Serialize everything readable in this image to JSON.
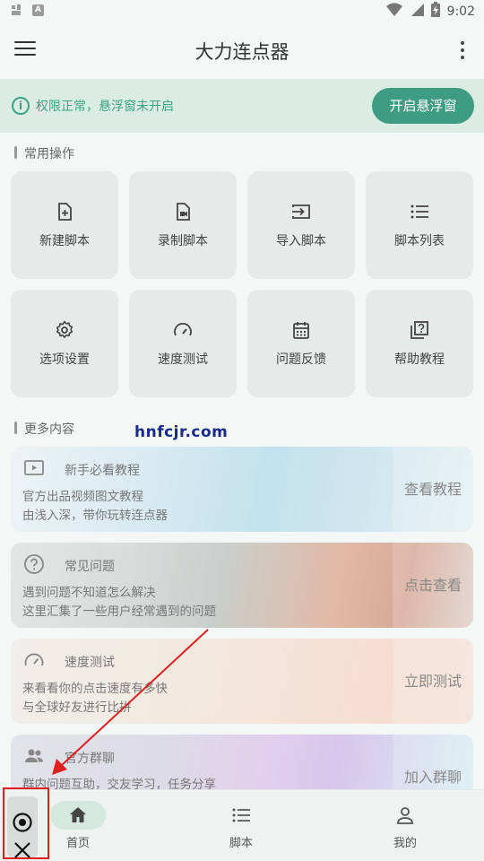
{
  "status_bar": {
    "time": "9:02",
    "left_icons": [
      "notification-icon",
      "a-icon"
    ],
    "right_icons": [
      "wifi-icon",
      "signal-icon",
      "battery-icon"
    ]
  },
  "app_bar": {
    "title": "大力连点器"
  },
  "notice": {
    "text": "权限正常，悬浮窗未开启",
    "button": "开启悬浮窗"
  },
  "sections": {
    "common": "常用操作",
    "more": "更多内容"
  },
  "quick_actions": [
    {
      "label": "新建脚本",
      "icon": "file-add-icon"
    },
    {
      "label": "录制脚本",
      "icon": "file-record-icon"
    },
    {
      "label": "导入脚本",
      "icon": "import-icon"
    },
    {
      "label": "脚本列表",
      "icon": "list-icon"
    },
    {
      "label": "选项设置",
      "icon": "gear-icon"
    },
    {
      "label": "速度测试",
      "icon": "speedometer-icon"
    },
    {
      "label": "问题反馈",
      "icon": "calendar-icon"
    },
    {
      "label": "帮助教程",
      "icon": "help-book-icon"
    }
  ],
  "cards": [
    {
      "title": "新手必看教程",
      "line1": "官方出品视频图文教程",
      "line2": "由浅入深，带你玩转连点器",
      "button": "查看教程",
      "icon": "video-icon"
    },
    {
      "title": "常见问题",
      "line1": "遇到问题不知道怎么解决",
      "line2": "这里汇集了一些用户经常遇到的问题",
      "button": "点击查看",
      "icon": "question-icon"
    },
    {
      "title": "速度测试",
      "line1": "来看看你的点击速度有多快",
      "line2": "与全球好友进行比拼",
      "button": "立即测试",
      "icon": "speedometer-icon"
    },
    {
      "title": "官方群聊",
      "line1": "群内问题互助，交友学习，任务分享",
      "line2": "",
      "button": "加入群聊",
      "icon": "group-icon"
    }
  ],
  "watermark": "hnfcjr.com",
  "bottom_nav": [
    {
      "label": "首页",
      "icon": "home-icon",
      "active": true
    },
    {
      "label": "脚本",
      "icon": "list-icon",
      "active": false
    },
    {
      "label": "我的",
      "icon": "user-icon",
      "active": false
    }
  ],
  "colors": {
    "accent": "#3e9d81",
    "notice_bg": "#dbece5",
    "annotation": "#e02020"
  }
}
